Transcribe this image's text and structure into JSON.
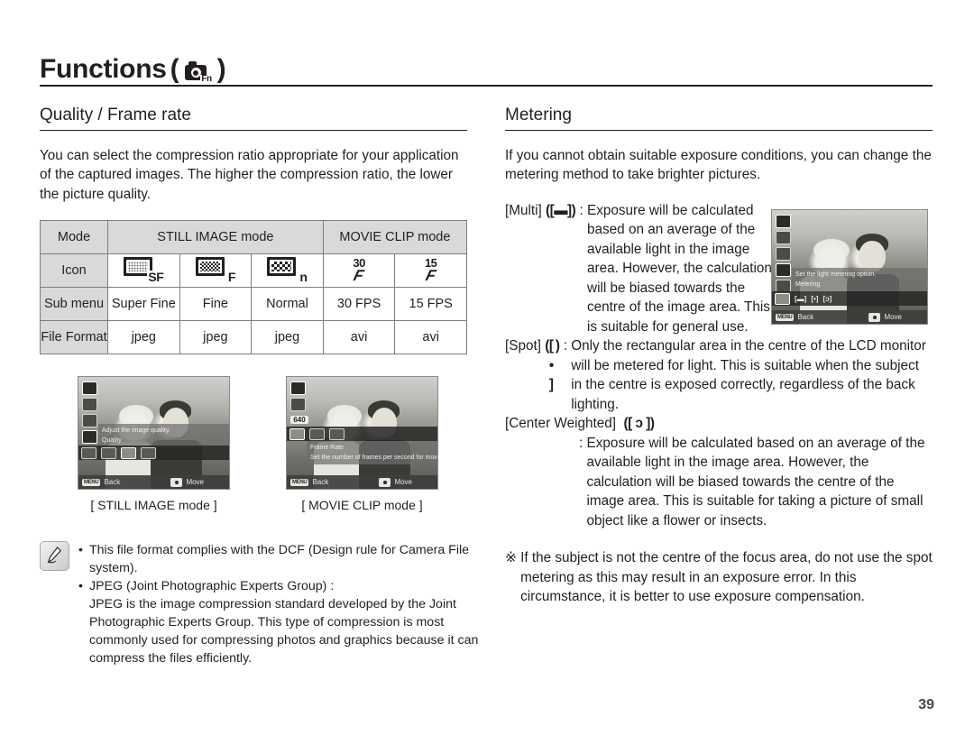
{
  "header": {
    "title": "Functions",
    "paren_open": "(",
    "paren_close": ")",
    "camera_fn_label": "Fn"
  },
  "left": {
    "section_title": "Quality / Frame rate",
    "intro": "You can select the compression ratio appropriate for your application of the captured images. The higher the compression ratio, the lower the picture quality.",
    "table": {
      "row_labels": [
        "Mode",
        "Icon",
        "Sub menu",
        "File Format"
      ],
      "group_headers": [
        {
          "label": "STILL IMAGE mode",
          "span": 3
        },
        {
          "label": "MOVIE CLIP mode",
          "span": 2
        }
      ],
      "icons": [
        {
          "letter": "SF",
          "pattern": "fine-dither"
        },
        {
          "letter": "F",
          "pattern": "medium-dither"
        },
        {
          "letter": "n",
          "pattern": "coarse-dither"
        },
        {
          "fps": "30",
          "glyph": "F"
        },
        {
          "fps": "15",
          "glyph": "F"
        }
      ],
      "sub_menu": [
        "Super Fine",
        "Fine",
        "Normal",
        "30 FPS",
        "15 FPS"
      ],
      "file_format": [
        "jpeg",
        "jpeg",
        "jpeg",
        "avi",
        "avi"
      ]
    },
    "lcd_still": {
      "info_line1": "Adjust the image quality.",
      "info_line2": "Quality",
      "back": "Back",
      "menu_key": "MENU",
      "move": "Move"
    },
    "lcd_movie": {
      "res_badge": "640",
      "info_line1": "Frame Rate",
      "info_line2": "Set the number of frames per second for movies.",
      "back": "Back",
      "menu_key": "MENU",
      "move": "Move"
    },
    "caption_still": "[ STILL IMAGE mode ]",
    "caption_movie": "[ MOVIE CLIP mode ]",
    "note": {
      "bullet1": "This file format complies with the DCF (Design rule for Camera File system).",
      "bullet2": "JPEG (Joint Photographic Experts Group) :",
      "bullet2_body": "JPEG is the image compression standard developed by the Joint Photographic Experts Group. This type of compression is most commonly used for compressing photos and graphics because it can compress the files efficiently."
    }
  },
  "right": {
    "section_title": "Metering",
    "intro": "If you cannot obtain suitable exposure conditions, you can change the metering method to take brighter pictures.",
    "multi": {
      "label": "[Multi]",
      "symbol_open": "(",
      "symbol": "[▬]",
      "symbol_close": ")",
      "colon": ":",
      "text": "Exposure will be calculated based on an average of the available light in the image area. However, the calculation will be biased towards the centre of the image area. This is suitable for general use."
    },
    "spot": {
      "label": "[Spot]",
      "symbol_open": "(",
      "symbol": "[ • ]",
      "symbol_close": ")",
      "colon": ":",
      "text": "Only the rectangular area in the centre of the LCD monitor will be metered for light. This is suitable when the subject in the centre is exposed correctly, regardless of the back lighting."
    },
    "center_weighted": {
      "label": "[Center Weighted]",
      "symbol_open": "(",
      "symbol": "[ ɔ ]",
      "symbol_close": ")",
      "colon": ":",
      "text": "Exposure will be calculated based on an average of the available light in the image area. However, the calculation will be biased towards the centre of the image area. This is suitable for taking a picture of small object like a flower or insects."
    },
    "footnote_mark": "※",
    "footnote": "If the subject is not the centre of the focus area, do not use the spot metering as this may result in an exposure error. In this circumstance, it is better to use exposure compensation.",
    "lcd_metering": {
      "info_line1": "Set the light metering option.",
      "info_line2": "Metering",
      "options": [
        "[▬]",
        "[•]",
        "[ɔ]"
      ],
      "back": "Back",
      "menu_key": "MENU",
      "move": "Move"
    }
  },
  "page_number": "39",
  "colors": {
    "ink": "#231f20",
    "table_header_fill": "#d9d9d9",
    "table_border": "#7d7d7d"
  }
}
